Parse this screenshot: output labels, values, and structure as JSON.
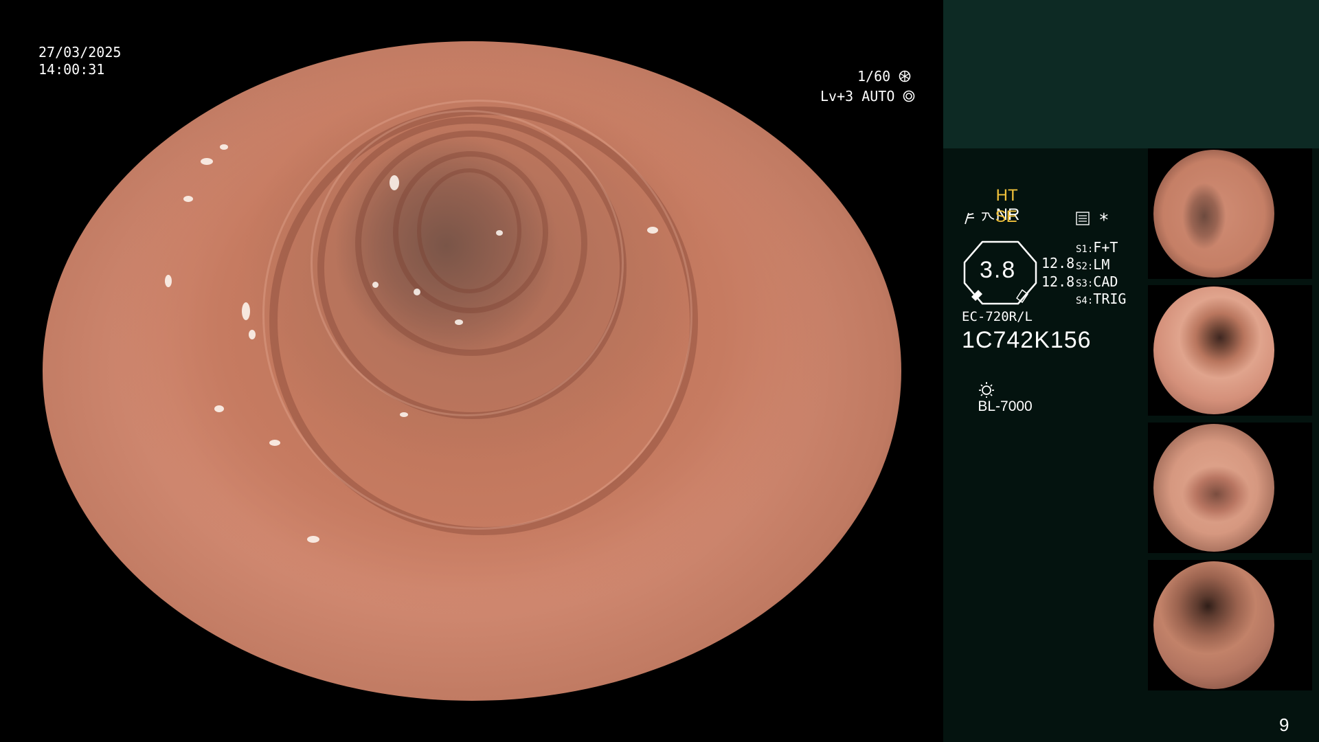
{
  "overlay": {
    "date": "27/03/2025",
    "time": "14:00:31",
    "shutter": "1/60",
    "shutter_icon": "shutter-icon",
    "iris": "Lv+3 AUTO",
    "iris_icon": "iris-icon"
  },
  "panel": {
    "mode_ht": "HT",
    "mode_nr": "NR",
    "mode_se": "SE",
    "se_icon": "enhance-icon",
    "freeze_icon": "freeze-icon",
    "menu_icon": "menu-icon",
    "star_label": "*",
    "gauge_value": "3.8",
    "gauge_side_top": "12.8",
    "gauge_side_bottom": "12.8",
    "switches": [
      {
        "key": "S1:",
        "value": "F+T"
      },
      {
        "key": "S2:",
        "value": "LM"
      },
      {
        "key": "S3:",
        "value": "CAD"
      },
      {
        "key": "S4:",
        "value": "TRIG"
      }
    ],
    "scope_model": "EC-720R/L",
    "serial": "1C742K156",
    "light_source": "BL-7000",
    "light_icon": "light-source-icon"
  },
  "page_number": "9",
  "colors": {
    "panel_bg": "#04130f",
    "panel_header": "#0d2a24",
    "accent_yellow": "#f1c23b",
    "tissue": "#d28a72"
  }
}
